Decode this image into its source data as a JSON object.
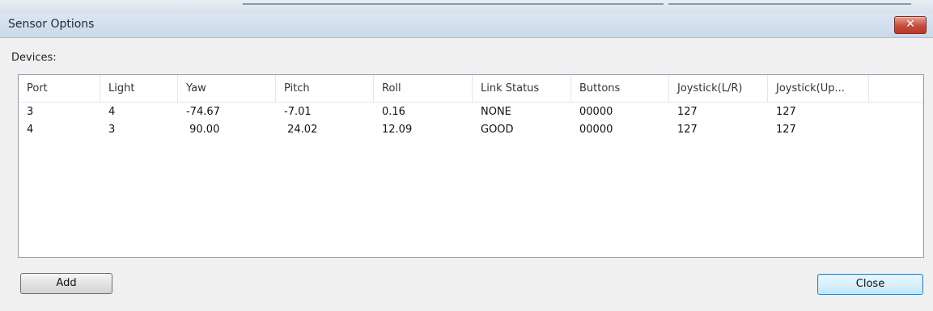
{
  "window": {
    "title": "Sensor Options",
    "close_glyph": "✕"
  },
  "devices_label": "Devices:",
  "table": {
    "columns": [
      "Port",
      "Light",
      "Yaw",
      "Pitch",
      "Roll",
      "Link Status",
      "Buttons",
      "Joystick(L/R)",
      "Joystick(Up..."
    ],
    "rows": [
      [
        "3",
        "4",
        "-74.67",
        "-7.01",
        "0.16",
        "NONE",
        "00000",
        "127",
        "127"
      ],
      [
        "4",
        "3",
        " 90.00",
        " 24.02",
        "12.09",
        "GOOD",
        "00000",
        "127",
        "127"
      ]
    ]
  },
  "buttons": {
    "add": "Add",
    "close": "Close"
  },
  "colors": {
    "titlebar": "#c9d8ea",
    "close_button": "#c74c3d",
    "default_button_border": "#3c7fb1"
  }
}
